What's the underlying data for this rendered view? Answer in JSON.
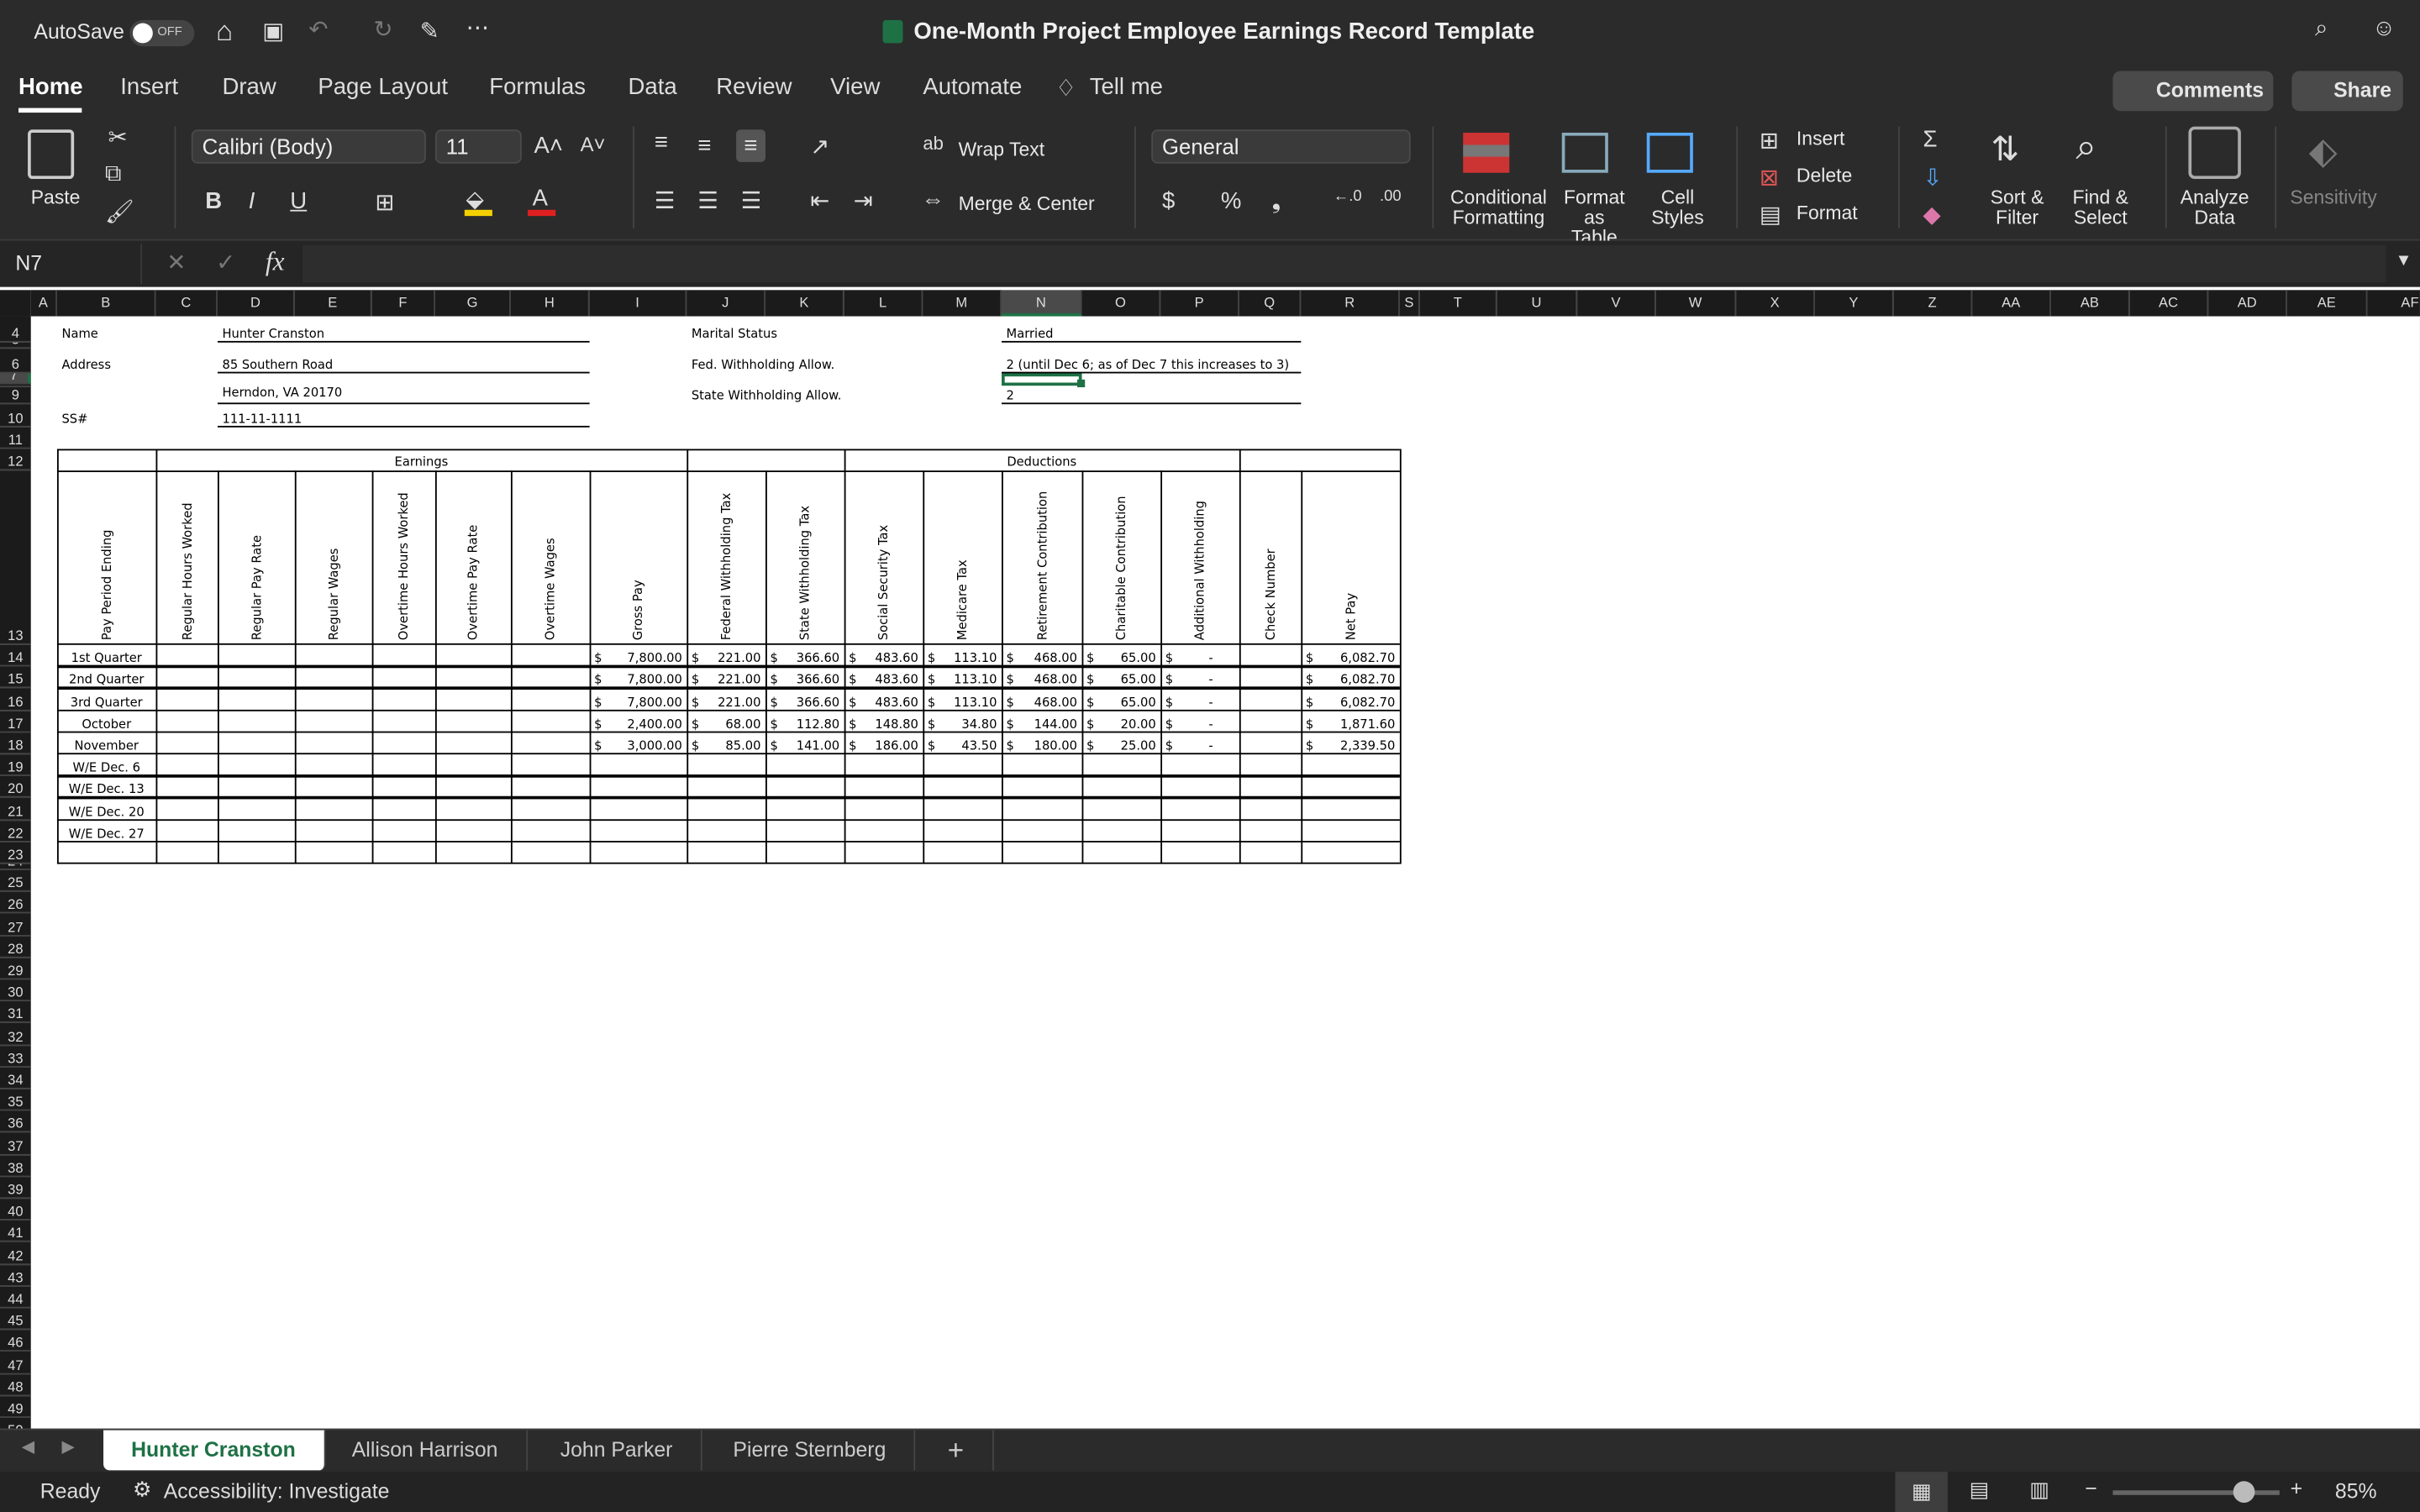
{
  "titlebar": {
    "autosave": "AutoSave",
    "autosave_state": "OFF",
    "title": "One-Month Project Employee Earnings Record Template"
  },
  "menu": {
    "tabs": [
      "Home",
      "Insert",
      "Draw",
      "Page Layout",
      "Formulas",
      "Data",
      "Review",
      "View",
      "Automate",
      "Tell me"
    ],
    "comments": "Comments",
    "share": "Share"
  },
  "ribbon": {
    "paste": "Paste",
    "font": "Calibri (Body)",
    "size": "11",
    "wrap_text": "Wrap Text",
    "merge_center": "Merge & Center",
    "number_format": "General",
    "conditional": "Conditional Formatting",
    "format_table": "Format as Table",
    "cell_styles": "Cell Styles",
    "insert": "Insert",
    "delete": "Delete",
    "format": "Format",
    "sort_filter": "Sort & Filter",
    "find_select": "Find & Select",
    "analyze": "Analyze Data",
    "sensitivity": "Sensitivity",
    "colors": {
      "highlight": "#f5d000",
      "font_color": "#e02020"
    }
  },
  "formula_bar": {
    "name_box": "N7",
    "formula": ""
  },
  "columns": [
    "A",
    "B",
    "C",
    "D",
    "E",
    "F",
    "G",
    "H",
    "I",
    "J",
    "K",
    "L",
    "M",
    "N",
    "O",
    "P",
    "Q",
    "R",
    "S",
    "T",
    "U",
    "V",
    "W",
    "X",
    "Y",
    "Z",
    "AA",
    "AB",
    "AC",
    "AD",
    "AE",
    "AF"
  ],
  "selected_column": "N",
  "info": {
    "name_label": "Name",
    "name": "Hunter Cranston",
    "address_label": "Address",
    "address1": "85 Southern Road",
    "address2": "Herndon, VA 20170",
    "ss_label": "SS#",
    "ss": "111-11-1111",
    "marital_label": "Marital Status",
    "marital": "Married",
    "fed_label": "Fed. Withholding Allow.",
    "fed": "2 (until Dec 6; as of Dec 7 this increases to 3)",
    "state_label": "State Withholding Allow.",
    "state": "2"
  },
  "table": {
    "group_earnings": "Earnings",
    "group_deductions": "Deductions",
    "headers": [
      "Pay Period Ending",
      "Regular Hours Worked",
      "Regular Pay Rate",
      "Regular Wages",
      "Overtime Hours Worked",
      "Overtime Pay Rate",
      "Overtime Wages",
      "Gross Pay",
      "Federal Withholding Tax",
      "State Withholding Tax",
      "Social Security Tax",
      "Medicare Tax",
      "Retirement Contribution",
      "Charitable Contribution",
      "Additional Withholding",
      "Check Number",
      "Net Pay"
    ],
    "rows": [
      {
        "period": "1st Quarter",
        "gross": "7,800.00",
        "fed": "221.00",
        "state": "366.60",
        "ss": "483.60",
        "medicare": "113.10",
        "retirement": "468.00",
        "charitable": "65.00",
        "additional": "-",
        "net": "6,082.70"
      },
      {
        "period": "2nd Quarter",
        "gross": "7,800.00",
        "fed": "221.00",
        "state": "366.60",
        "ss": "483.60",
        "medicare": "113.10",
        "retirement": "468.00",
        "charitable": "65.00",
        "additional": "-",
        "net": "6,082.70"
      },
      {
        "period": "3rd Quarter",
        "gross": "7,800.00",
        "fed": "221.00",
        "state": "366.60",
        "ss": "483.60",
        "medicare": "113.10",
        "retirement": "468.00",
        "charitable": "65.00",
        "additional": "-",
        "net": "6,082.70"
      },
      {
        "period": "October",
        "gross": "2,400.00",
        "fed": "68.00",
        "state": "112.80",
        "ss": "148.80",
        "medicare": "34.80",
        "retirement": "144.00",
        "charitable": "20.00",
        "additional": "-",
        "net": "1,871.60"
      },
      {
        "period": "November",
        "gross": "3,000.00",
        "fed": "85.00",
        "state": "141.00",
        "ss": "186.00",
        "medicare": "43.50",
        "retirement": "180.00",
        "charitable": "25.00",
        "additional": "-",
        "net": "2,339.50"
      },
      {
        "period": "W/E Dec. 6"
      },
      {
        "period": "W/E Dec. 13"
      },
      {
        "period": "W/E Dec. 20"
      },
      {
        "period": "W/E Dec. 27"
      },
      {
        "period": ""
      }
    ],
    "currency": "$"
  },
  "sheets": {
    "tabs": [
      "Hunter Cranston",
      "Allison Harrison",
      "John Parker",
      "Pierre Sternberg"
    ],
    "active": 0,
    "add": "+"
  },
  "status": {
    "ready": "Ready",
    "accessibility": "Accessibility: Investigate",
    "zoom": "85%",
    "zoom_level": 0.85
  }
}
